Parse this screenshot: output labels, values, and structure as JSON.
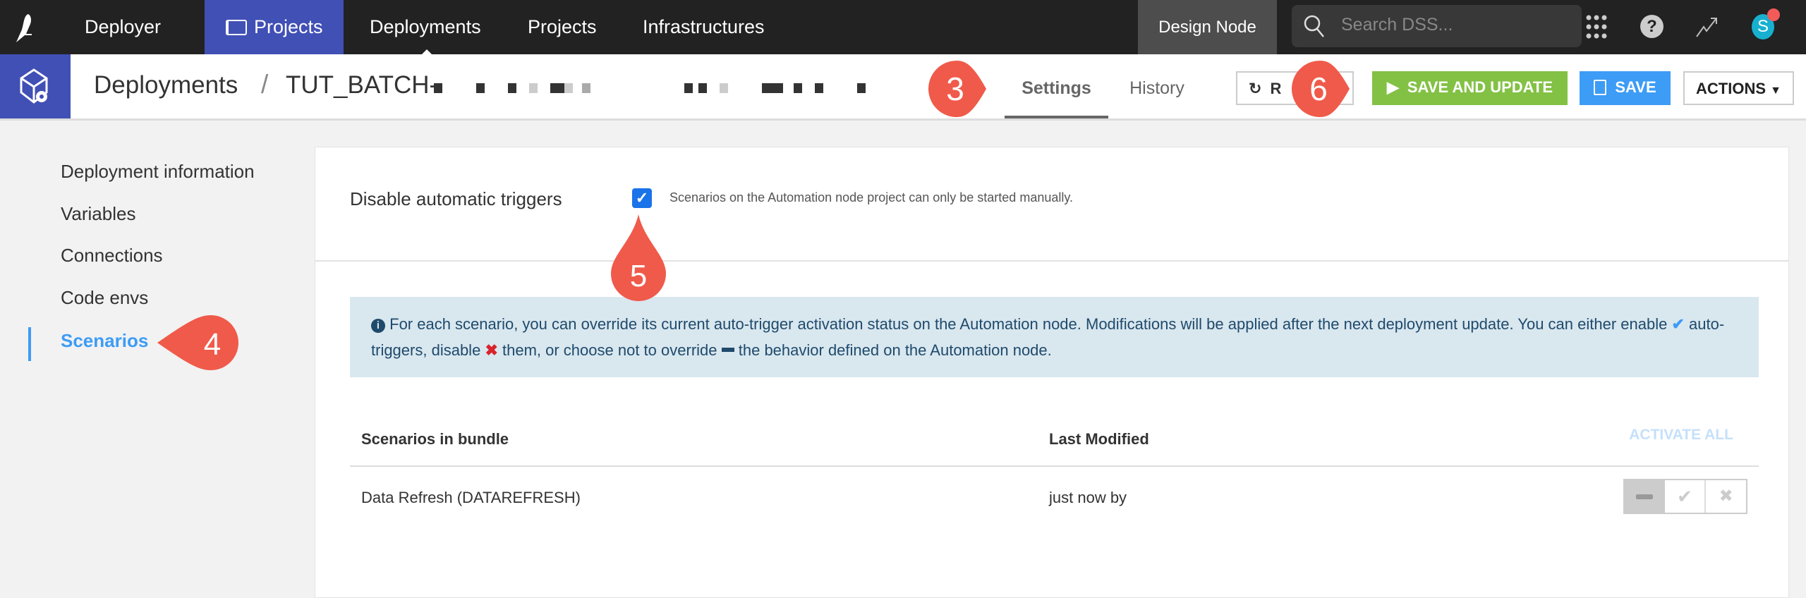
{
  "topbar": {
    "app_name": "Deployer",
    "active_tab": "Projects",
    "nav": [
      "Deployments",
      "Projects",
      "Infrastructures"
    ],
    "design_node": "Design Node",
    "search_placeholder": "Search DSS...",
    "avatar_letter": "S",
    "icons": [
      "dataiku-bird-icon",
      "projects-icon",
      "search-icon",
      "apps-grid-icon",
      "help-icon",
      "trend-icon",
      "avatar"
    ]
  },
  "header": {
    "breadcrumb_root": "Deployments",
    "separator": "/",
    "deployment_name": "TUT_BATCH-",
    "tabs": [
      "Settings",
      "History"
    ],
    "active_tab": "Settings",
    "refresh_label": "R",
    "save_update_label": "SAVE AND UPDATE",
    "save_label": "SAVE",
    "actions_label": "ACTIONS"
  },
  "sidebar": {
    "items": [
      "Deployment information",
      "Variables",
      "Connections",
      "Code envs",
      "Scenarios"
    ],
    "active": "Scenarios"
  },
  "settings": {
    "disable_label": "Disable automatic triggers",
    "disable_checked": true,
    "disable_help": "Scenarios on the Automation node project can only be started manually.",
    "info_part1": "For each scenario, you can override its current auto-trigger activation status on the Automation node. Modifications will be applied after the next deployment update. You can either enable",
    "info_part2": "auto-triggers, disable",
    "info_part3": "them, or choose not to override",
    "info_part4": "the behavior defined on the Automation node."
  },
  "table": {
    "col_scenarios": "Scenarios in bundle",
    "col_modified": "Last Modified",
    "activate_all": "ACTIVATE ALL",
    "rows": [
      {
        "name": "Data Refresh (DATAREFRESH)",
        "modified": "just now by",
        "state": "no-override"
      }
    ]
  },
  "callouts": [
    "3",
    "4",
    "5",
    "6"
  ],
  "colors": {
    "brand": "#4150b5",
    "green": "#83c145",
    "blue": "#3d9cf5",
    "callout": "#f05a4a",
    "info_bg": "#d9e7ef",
    "info_text": "#1f4a6b"
  }
}
